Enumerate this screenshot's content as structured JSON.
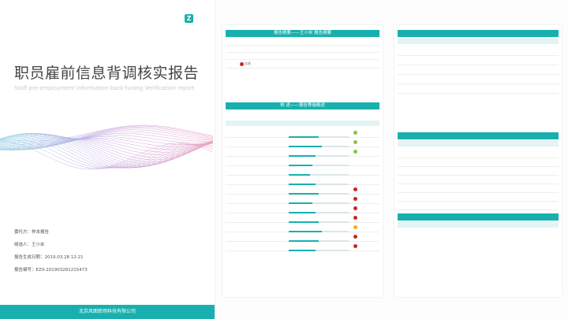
{
  "cover": {
    "logo_mark": "Z",
    "logo_text": "",
    "logo_sub": "",
    "title": "职员雇前信息背调核实报告",
    "subtitle": "Staff pre-employment information back-tuning Verification report",
    "client_label": "委托方：",
    "client_value": "样本报告",
    "subject_label": "候选人：",
    "subject_value": "王小米",
    "date_label": "报告生成日期：",
    "date_value": "2019.03.28 12:21",
    "number_label": "报告编号：",
    "number_value": "EZX-201903281215473",
    "footer": "北京风图职场科技有限公司",
    "accent": "#17b0ae"
  },
  "page2": {
    "overview_title": "报告摘要——王小米 报告摘要",
    "overview_rows": [
      [
        "",
        "",
        "",
        ""
      ],
      [
        "",
        "",
        "",
        ""
      ],
      [
        "",
        "",
        "",
        ""
      ]
    ],
    "status_row_mark": "",
    "status_row_label": "红线",
    "status_row_mid": "",
    "status_row_value": "",
    "summary_title": "核 述——报告等级概述",
    "legend_text": "",
    "summary_cols": [
      "",
      "",
      ""
    ],
    "summary_rows": [
      {
        "a": "",
        "b": "",
        "s": "good",
        "t": "",
        "progress": 0.5
      },
      {
        "a": "",
        "b": "",
        "s": "good",
        "t": "",
        "progress": 0.55
      },
      {
        "a": "",
        "b": "",
        "s": "good",
        "t": "",
        "progress": 0.45
      },
      {
        "a": "",
        "b": "",
        "s": "none",
        "t": "",
        "progress": 0.4
      },
      {
        "a": "",
        "b": "",
        "s": "none",
        "t": "",
        "progress": 0.35
      },
      {
        "a": "",
        "b": "",
        "s": "none",
        "t": "",
        "progress": 0.45
      },
      {
        "a": "",
        "b": "",
        "s": "bad",
        "t": "",
        "progress": 0.5
      },
      {
        "a": "",
        "b": "",
        "s": "bad",
        "t": "",
        "progress": 0.4
      },
      {
        "a": "",
        "b": "",
        "s": "bad",
        "t": "",
        "progress": 0.45
      },
      {
        "a": "",
        "b": "",
        "s": "bad",
        "t": "",
        "progress": 0.5
      },
      {
        "a": "",
        "b": "",
        "s": "warn",
        "t": "",
        "progress": 0.55
      },
      {
        "a": "",
        "b": "",
        "s": "bad",
        "t": "",
        "progress": 0.5
      },
      {
        "a": "",
        "b": "",
        "s": "bad",
        "t": "",
        "progress": 0.45
      }
    ],
    "page_number": ""
  },
  "page3": {
    "section3_title": "",
    "section3_cols": [
      "",
      "",
      ""
    ],
    "section3_rows": [
      [
        "",
        "",
        ""
      ],
      [
        "",
        "",
        ""
      ],
      [
        "",
        "",
        ""
      ],
      [
        "",
        "",
        ""
      ],
      [
        "",
        "",
        ""
      ]
    ],
    "section3_note": "",
    "section4_title": "",
    "section4_cols": [
      "",
      "",
      ""
    ],
    "section4_rows": [
      [
        "",
        "",
        ""
      ],
      [
        "",
        "",
        ""
      ],
      [
        "",
        "",
        ""
      ],
      [
        "",
        "",
        ""
      ],
      [
        "",
        "",
        ""
      ],
      [
        "",
        "",
        ""
      ],
      [
        "",
        "",
        ""
      ]
    ],
    "section4_note": "",
    "section5_title": "",
    "section5_cols": [
      "",
      ""
    ],
    "section5_amount": "",
    "section5_lines": [
      "",
      "",
      "",
      ""
    ],
    "section5_note": "",
    "page_number": ""
  }
}
